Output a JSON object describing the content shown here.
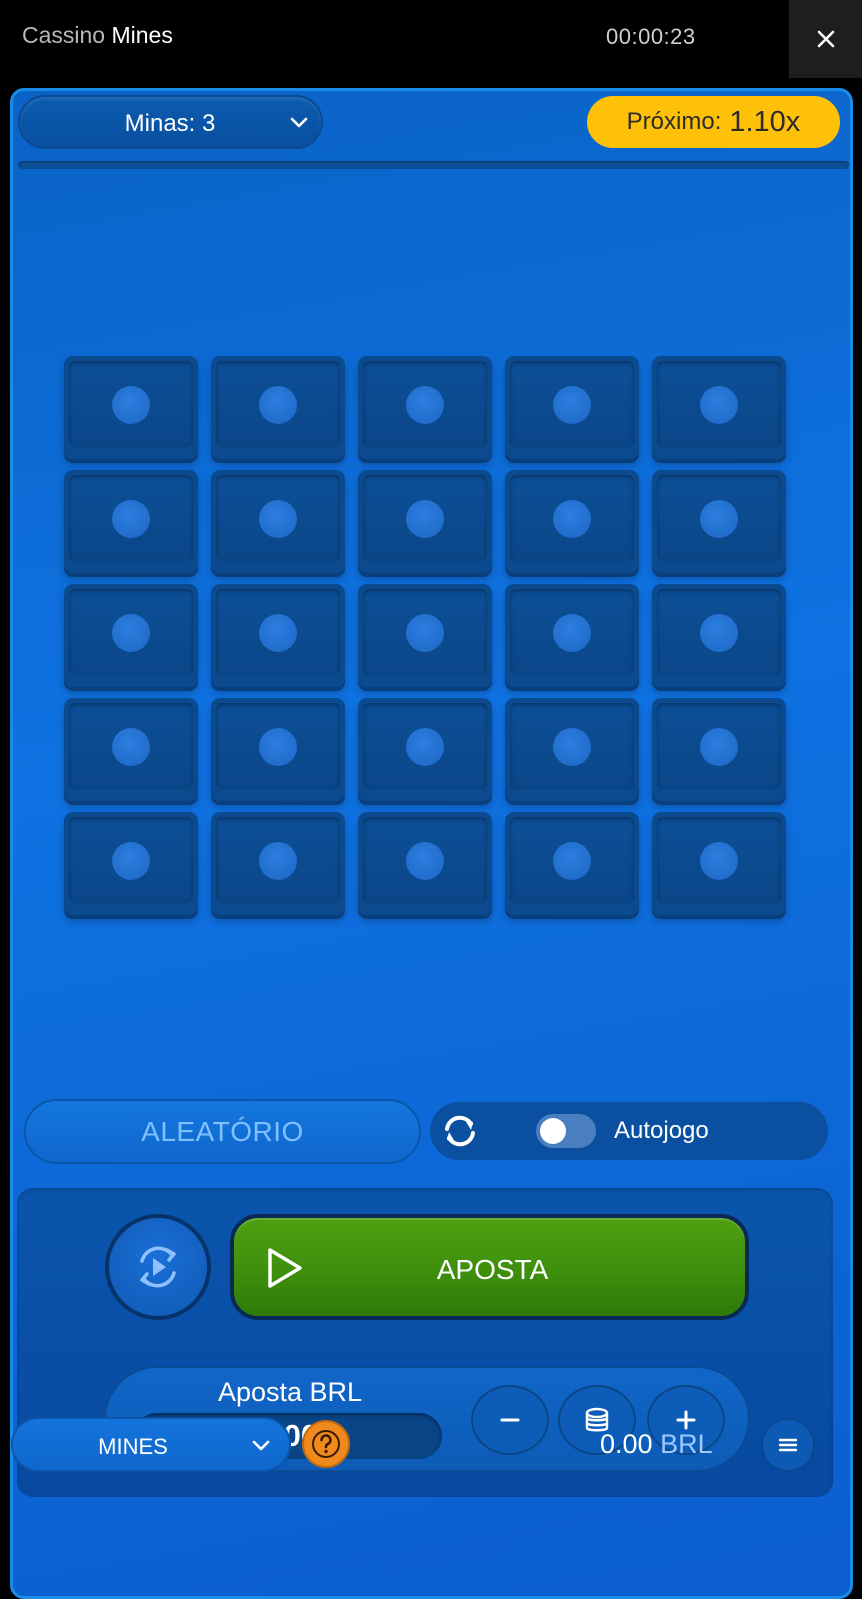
{
  "header": {
    "title_lead": "Cassino",
    "title_main": "Mines",
    "timer": "00:00:23"
  },
  "game": {
    "mines_label": "Minas: 3",
    "next_label": "Próximo:",
    "next_multiplier": "1.10x",
    "grid": {
      "rows": 5,
      "cols": 5
    }
  },
  "controls": {
    "random_label": "ALEATÓRIO",
    "autoplay_label": "Autojogo",
    "autoplay_on": false,
    "bet_button_label": "APOSTA",
    "stake_title": "Aposta BRL",
    "stake_value": "1.00"
  },
  "footer": {
    "game_select": "MINES",
    "balance_value": "0.00",
    "balance_currency": "BRL"
  },
  "colors": {
    "accent": "#ffc107",
    "bet_green": "#3e8f0c",
    "panel_blue": "#0f72e2",
    "help_orange": "#f08a1c"
  },
  "icons": [
    "close-icon",
    "chevron-down-icon",
    "sync-icon",
    "auto-play-icon",
    "play-icon",
    "minus-icon",
    "coins-icon",
    "plus-icon",
    "help-icon",
    "menu-icon"
  ]
}
